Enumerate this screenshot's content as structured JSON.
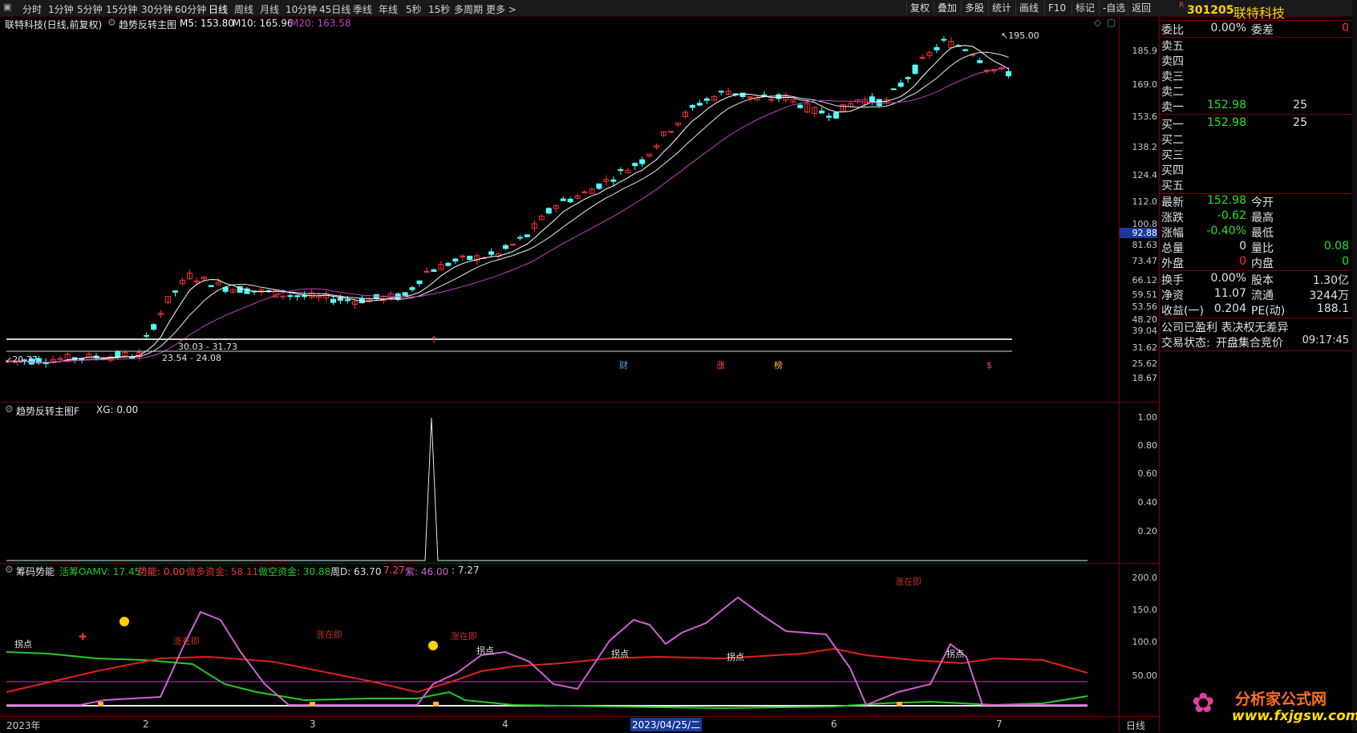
{
  "toolbar": {
    "periods": [
      "分时",
      "1分钟",
      "5分钟",
      "15分钟",
      "30分钟",
      "60分钟",
      "日线",
      "周线",
      "月线",
      "10分钟",
      "45日线",
      "季线",
      "年线",
      "5秒",
      "15秒",
      "多周期",
      "更多 >"
    ],
    "active_period": "日线",
    "right_buttons": [
      "复权",
      "叠加",
      "多股",
      "统计",
      "画线",
      "F10",
      "标记",
      "-自选",
      "返回"
    ]
  },
  "main_chart": {
    "title": "联特科技(日线,前复权)",
    "indicator": "趋势反转主图",
    "ma": [
      {
        "label": "M5: 153.80",
        "color": "#ffffff"
      },
      {
        "label": "M10: 165.96",
        "color": "#e8e8e8"
      },
      {
        "label": "M20: 163.58",
        "color": "#c040c0"
      }
    ],
    "y_axis_ticks": [
      "185.9",
      "169.0",
      "153.6",
      "138.2",
      "124.4",
      "112.0",
      "100.8",
      "92.88",
      "81.63",
      "73.47",
      "66.12",
      "59.51",
      "53.56",
      "48.20",
      "39.04",
      "31.62",
      "25.62",
      "18.67"
    ],
    "current_price_tag": "92.88",
    "annotations": {
      "high": "195.00",
      "low": "20.77",
      "range1": "30.03 - 31.73",
      "range2": "23.54 - 24.08"
    },
    "markers": [
      "财",
      "涨",
      "榜",
      "$"
    ]
  },
  "panel2": {
    "title": "趋势反转主图F",
    "xg": "XG: 0.00",
    "y_axis_ticks": [
      "1.00",
      "0.80",
      "0.60",
      "0.40",
      "0.20"
    ]
  },
  "panel3": {
    "title": "筹码势能",
    "fields": [
      {
        "label": "活筹OAMV: 17.45",
        "color": "#28c828"
      },
      {
        "label": "势能: 0.00",
        "color": "#ff4040"
      },
      {
        "label": "做多资金: 58.11",
        "color": "#e03030"
      },
      {
        "label": "做空资金: 30.88",
        "color": "#28c828"
      },
      {
        "label": "周D: 63.70",
        "color": "#e0e0e0"
      },
      {
        "label": "7.27",
        "color": "#ff5050"
      },
      {
        "label": "紫: 46.00",
        "color": "#d060d0"
      },
      {
        "label": ": 7.27",
        "color": "#e0e0e0"
      }
    ],
    "y_axis_ticks": [
      "200.0",
      "150.0",
      "100.0",
      "50.00"
    ],
    "labels": {
      "guaidian": "拐点",
      "zhangzaiji": "涨在即",
      "daily": "日线"
    }
  },
  "x_axis": {
    "labels": [
      "2023年",
      "2",
      "3",
      "4",
      "5",
      "6",
      "7"
    ],
    "cursor_date": "2023/04/25/二"
  },
  "stock": {
    "code": "301205",
    "name": "联特科技",
    "weibi_label": "委比",
    "weibi_value": "0.00%",
    "weicha_label": "委差",
    "weicha_value": "0",
    "sell": [
      {
        "label": "卖五",
        "price": "",
        "vol": ""
      },
      {
        "label": "卖四",
        "price": "",
        "vol": ""
      },
      {
        "label": "卖三",
        "price": "",
        "vol": ""
      },
      {
        "label": "卖二",
        "price": "",
        "vol": ""
      },
      {
        "label": "卖一",
        "price": "152.98",
        "vol": "25"
      }
    ],
    "buy": [
      {
        "label": "买一",
        "price": "152.98",
        "vol": "25"
      },
      {
        "label": "买二",
        "price": "",
        "vol": ""
      },
      {
        "label": "买三",
        "price": "",
        "vol": ""
      },
      {
        "label": "买四",
        "price": "",
        "vol": ""
      },
      {
        "label": "买五",
        "price": "",
        "vol": ""
      }
    ],
    "quote": [
      {
        "l1": "最新",
        "v1": "152.98",
        "c1": "#28e028",
        "l2": "今开",
        "v2": "",
        "c2": "#e0e0e0"
      },
      {
        "l1": "涨跌",
        "v1": "-0.62",
        "c1": "#28e028",
        "l2": "最高",
        "v2": "",
        "c2": "#e0e0e0"
      },
      {
        "l1": "涨幅",
        "v1": "-0.40%",
        "c1": "#28e028",
        "l2": "最低",
        "v2": "",
        "c2": "#e0e0e0"
      },
      {
        "l1": "总量",
        "v1": "0",
        "c1": "#e0e0e0",
        "l2": "量比",
        "v2": "0.08",
        "c2": "#28e028"
      },
      {
        "l1": "外盘",
        "v1": "0",
        "c1": "#ff3030",
        "l2": "内盘",
        "v2": "0",
        "c2": "#28e028"
      }
    ],
    "fund": [
      {
        "l1": "换手",
        "v1": "0.00%",
        "l2": "股本",
        "v2": "1.30亿"
      },
      {
        "l1": "净资",
        "v1": "11.07",
        "l2": "流通",
        "v2": "3244万"
      },
      {
        "l1": "收益(一)",
        "v1": "0.204",
        "l2": "PE(动)",
        "v2": "188.1"
      }
    ],
    "note": "公司已盈利 表决权无差异",
    "status_label": "交易状态:",
    "status_value": "开盘集合竞价",
    "time": "09:17:45"
  },
  "watermark": {
    "title": "分析家公式网",
    "url": "www.fxjgsw.com"
  },
  "colors": {
    "up": "#ff3030",
    "down": "#54ffff",
    "grid": "#7a0000",
    "panel_bg": "#000000"
  }
}
